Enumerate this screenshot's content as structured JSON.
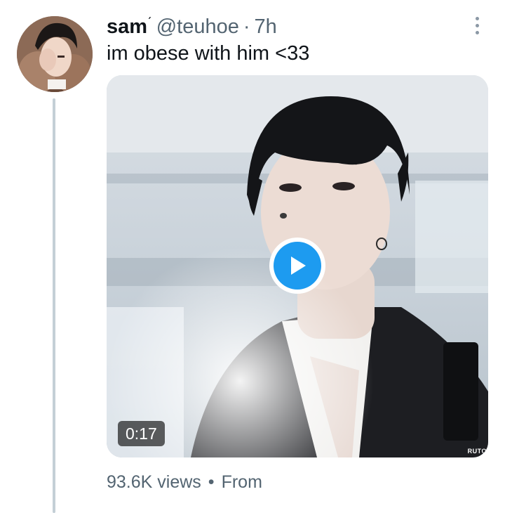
{
  "tweet": {
    "display_name": "sam",
    "name_suffix_glyph": "ˊ",
    "handle": "@teuhoe",
    "separator": "·",
    "time": "7h",
    "text": "im obese with him <33",
    "more_icon": "more-vertical-icon"
  },
  "media": {
    "type": "video",
    "duration": "0:17",
    "watermark": "RUTO",
    "play_icon": "play-icon",
    "accent_color": "#1d9bf0"
  },
  "footer": {
    "views": "93.6K views",
    "separator": "•",
    "source": "From"
  },
  "colors": {
    "text_primary": "#0f1419",
    "text_secondary": "#536471",
    "thread_line": "#c4cfd6"
  }
}
